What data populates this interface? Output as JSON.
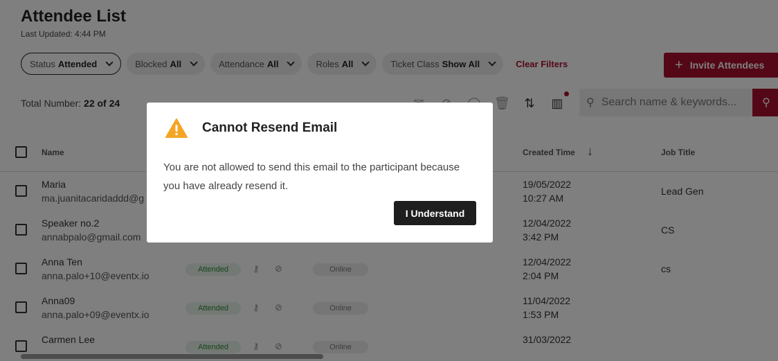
{
  "page": {
    "title": "Attendee List",
    "last_updated": "Last Updated: 4:44 PM"
  },
  "filters": [
    {
      "label": "Status",
      "value": "Attended"
    },
    {
      "label": "Blocked",
      "value": "All"
    },
    {
      "label": "Attendance",
      "value": "All"
    },
    {
      "label": "Roles",
      "value": "All"
    },
    {
      "label": "Ticket Class",
      "value": "Show All"
    }
  ],
  "clear_filters": "Clear Filters",
  "invite_button": "Invite Attendees",
  "total": {
    "label": "Total Number:",
    "value": "22 of 24"
  },
  "toolbar_icons": [
    "mail-icon",
    "block-icon",
    "check-circle-icon",
    "trash-icon",
    "sort-icon",
    "columns-icon"
  ],
  "search": {
    "placeholder": "Search name & keywords..."
  },
  "table": {
    "headers": {
      "name": "Name",
      "created_time": "Created Time",
      "job_title": "Job Title"
    },
    "rows": [
      {
        "name": "Maria",
        "email": "ma.juanitacaridaddd@g",
        "status": "",
        "attendance": "",
        "date": "19/05/2022",
        "time": "10:27 AM",
        "job": "Lead Gen"
      },
      {
        "name": "Speaker no.2",
        "email": "annabpalo@gmail.com",
        "status": "",
        "attendance": "",
        "date": "12/04/2022",
        "time": "3:42 PM",
        "job": "CS"
      },
      {
        "name": "Anna Ten",
        "email": "anna.palo+10@eventx.io",
        "status": "Attended",
        "attendance": "Online",
        "date": "12/04/2022",
        "time": "2:04 PM",
        "job": "cs"
      },
      {
        "name": "Anna09",
        "email": "anna.palo+09@eventx.io",
        "status": "Attended",
        "attendance": "Online",
        "date": "11/04/2022",
        "time": "1:53 PM",
        "job": ""
      },
      {
        "name": "Carmen Lee",
        "email": "",
        "status": "Attended",
        "attendance": "Online",
        "date": "31/03/2022",
        "time": "",
        "job": ""
      }
    ]
  },
  "modal": {
    "title": "Cannot Resend Email",
    "body": "You are not allowed to send this email to the participant because you have already resend it.",
    "button": "I Understand",
    "icon": "warning-icon",
    "icon_color": "#f5a524"
  },
  "colors": {
    "accent": "#a8102f"
  }
}
